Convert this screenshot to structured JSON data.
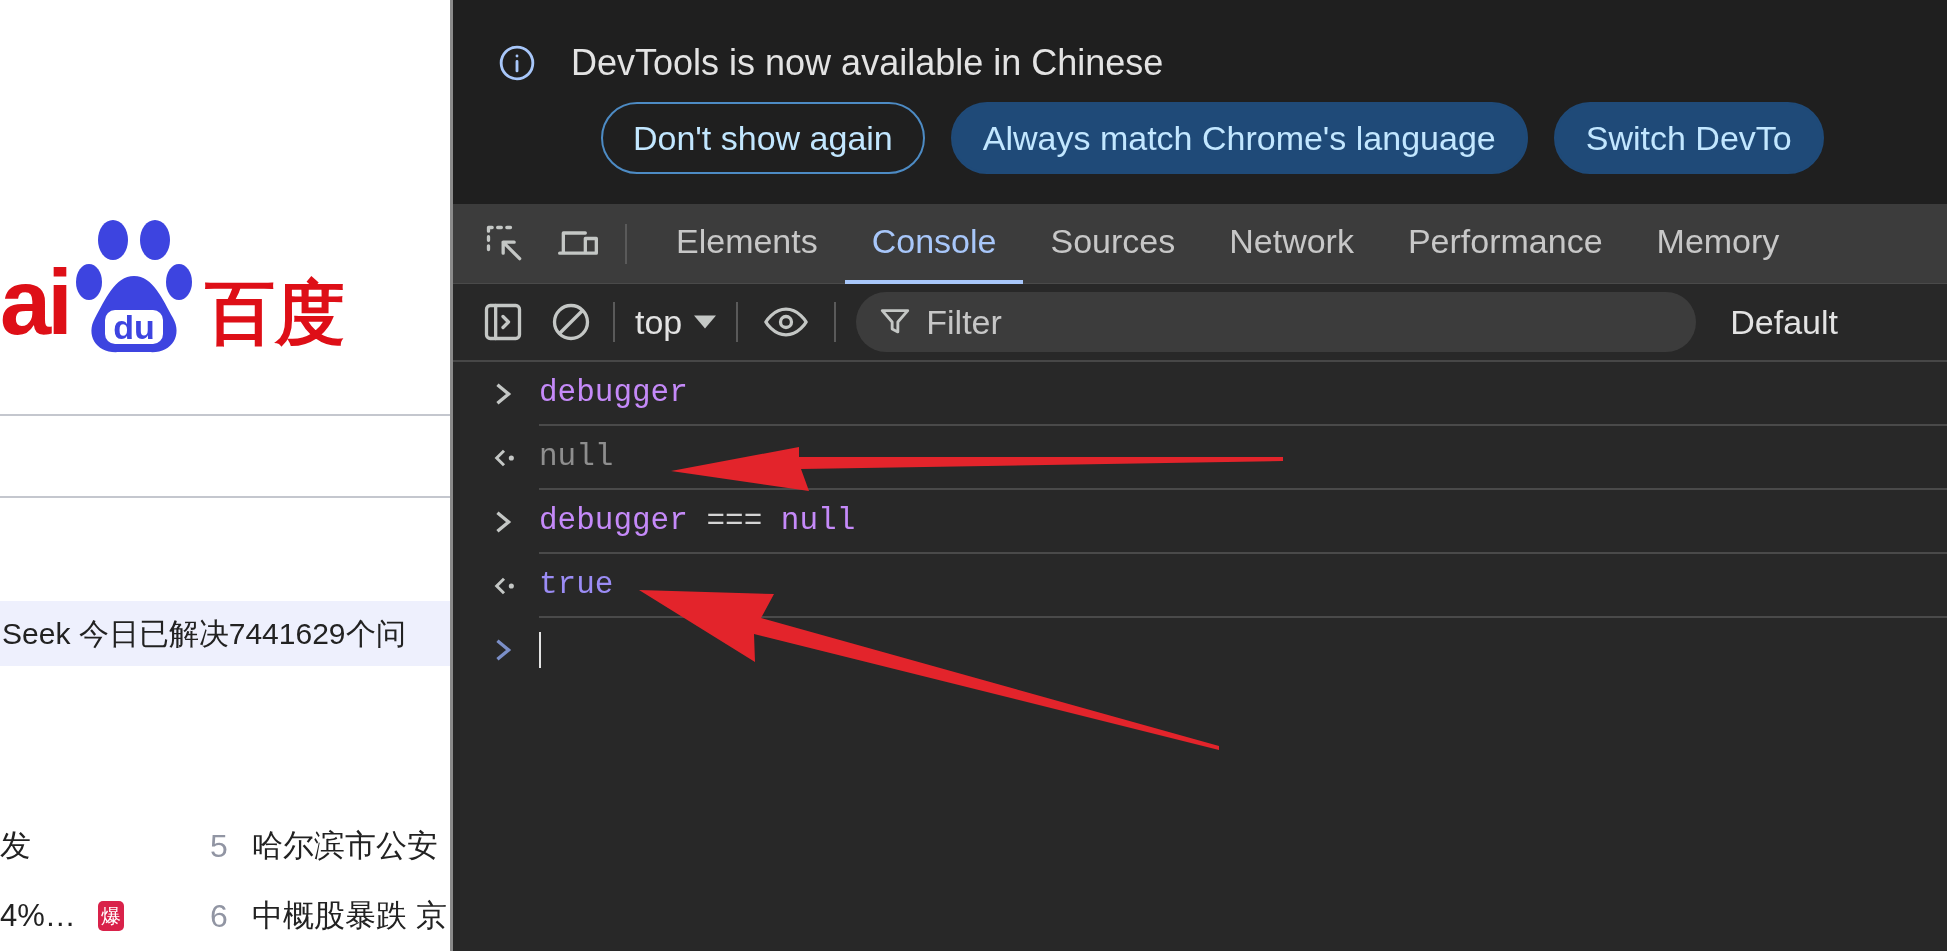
{
  "page": {
    "logo": {
      "latin": "ai",
      "paw_text": "du",
      "chinese": "百度"
    },
    "banner": "Seek 今日已解决7441629个问",
    "hot_list": [
      {
        "title": "发"
      },
      {
        "title": "4%…",
        "badge": "爆"
      },
      {
        "rank": "5",
        "title": "哈尔滨市公安"
      },
      {
        "rank": "6",
        "title": "中概股暴跌 京"
      }
    ]
  },
  "devtools": {
    "infobar": {
      "message": "DevTools is now available in Chinese",
      "buttons": [
        {
          "label": "Don't show again",
          "kind": "outline"
        },
        {
          "label": "Always match Chrome's language",
          "kind": "filled"
        },
        {
          "label": "Switch DevTo",
          "kind": "filled"
        }
      ]
    },
    "tabs": [
      {
        "label": "Elements",
        "selected": false
      },
      {
        "label": "Console",
        "selected": true
      },
      {
        "label": "Sources",
        "selected": false
      },
      {
        "label": "Network",
        "selected": false
      },
      {
        "label": "Performance",
        "selected": false
      },
      {
        "label": "Memory",
        "selected": false
      }
    ],
    "toolbar": {
      "context": "top",
      "filter": {
        "placeholder": "Filter"
      },
      "levels": "Default"
    },
    "console": [
      {
        "kind": "input",
        "tokens": [
          {
            "text": "debugger",
            "kind": "keyword"
          }
        ]
      },
      {
        "kind": "result",
        "tokens": [
          {
            "text": "null",
            "kind": "null"
          }
        ]
      },
      {
        "kind": "input",
        "tokens": [
          {
            "text": "debugger",
            "kind": "keyword"
          },
          {
            "text": "===",
            "kind": "operator"
          },
          {
            "text": "null",
            "kind": "keyword"
          }
        ]
      },
      {
        "kind": "result",
        "tokens": [
          {
            "text": "true",
            "kind": "boolean"
          }
        ]
      },
      {
        "kind": "prompt"
      }
    ]
  }
}
